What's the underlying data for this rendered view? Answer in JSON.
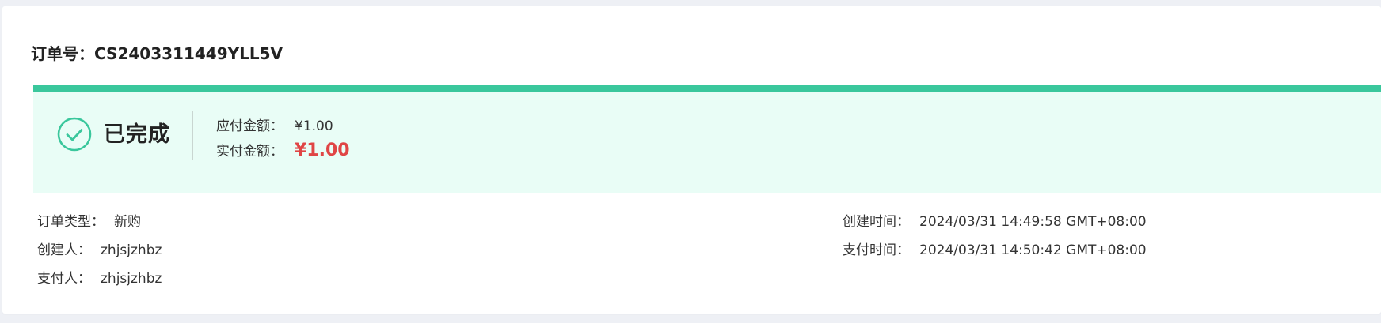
{
  "order": {
    "label": "订单号：",
    "number": "CS2403311449YLL5V"
  },
  "status": {
    "text": "已完成",
    "icon": "check-circle-icon",
    "accent_color": "#3ac79c",
    "panel_bg": "#e9fdf6"
  },
  "amounts": {
    "due_label": "应付金额：",
    "due_value": "¥1.00",
    "paid_label": "实付金额：",
    "paid_value": "¥1.00",
    "paid_color": "#e04545"
  },
  "details": {
    "order_type_label": "订单类型：",
    "order_type_value": "新购",
    "creator_label": "创建人：",
    "creator_value": "zhjsjzhbz",
    "payer_label": "支付人：",
    "payer_value": "zhjsjzhbz",
    "created_time_label": "创建时间：",
    "created_time_value": "2024/03/31 14:49:58 GMT+08:00",
    "paid_time_label": "支付时间：",
    "paid_time_value": "2024/03/31 14:50:42 GMT+08:00"
  }
}
